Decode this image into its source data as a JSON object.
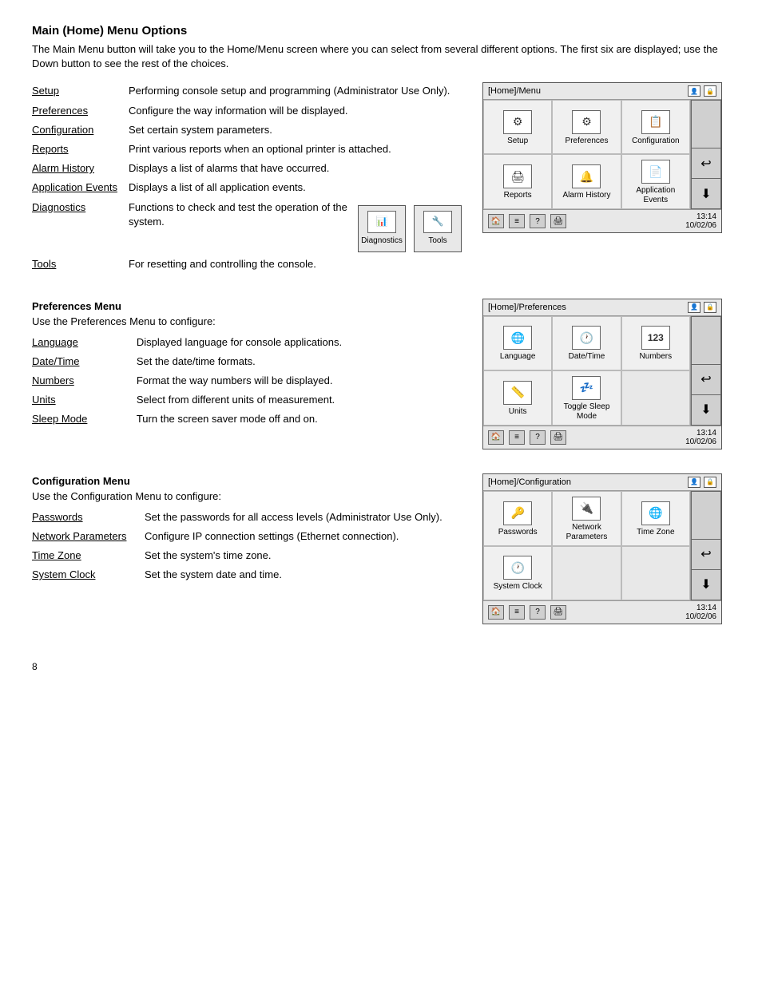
{
  "page": {
    "number": "8"
  },
  "main_section": {
    "title": "Main (Home) Menu Options",
    "intro": "The Main Menu button will take you to the Home/Menu screen where you can select from several different options. The first six are displayed; use the Down button to see the rest of the choices.",
    "items": [
      {
        "label": "Setup",
        "description": "Performing console setup and programming (Administrator Use Only)."
      },
      {
        "label": "Preferences",
        "description": "Configure the way information will be displayed."
      },
      {
        "label": "Configuration",
        "description": "Set certain system parameters."
      },
      {
        "label": "Reports",
        "description": "Print various reports when an optional printer is attached."
      },
      {
        "label": "Alarm History",
        "description": "Displays a list of alarms that have occurred."
      },
      {
        "label": "Application Events",
        "description": "Displays a list of all application events."
      },
      {
        "label": "Diagnostics",
        "description": "Functions to check and test the operation of the system."
      },
      {
        "label": "Tools",
        "description": "For resetting and controlling the console."
      }
    ],
    "screen": {
      "title": "[Home]/Menu",
      "time": "13:14",
      "date": "10/02/06",
      "row1": [
        "Setup",
        "Preferences",
        "Configuration"
      ],
      "row2": [
        "Reports",
        "Alarm History",
        "Application Events"
      ]
    }
  },
  "preferences_section": {
    "title": "Preferences Menu",
    "intro": "Use the Preferences Menu to configure:",
    "items": [
      {
        "label": "Language",
        "description": "Displayed language for console applications."
      },
      {
        "label": "Date/Time",
        "description": "Set the date/time formats."
      },
      {
        "label": "Numbers",
        "description": "Format the way numbers will be displayed."
      },
      {
        "label": "Units",
        "description": "Select from different units of measurement."
      },
      {
        "label": "Sleep Mode",
        "description": "Turn the screen saver mode off and on."
      }
    ],
    "screen": {
      "title": "[Home]/Preferences",
      "time": "13:14",
      "date": "10/02/06",
      "row1": [
        "Language",
        "Date/Time",
        "Numbers"
      ],
      "row2": [
        "Units",
        "Toggle Sleep Mode",
        ""
      ]
    }
  },
  "configuration_section": {
    "title": "Configuration Menu",
    "intro": "Use the Configuration Menu to configure:",
    "items": [
      {
        "label": "Passwords",
        "description": "Set the passwords for all access levels (Administrator Use Only)."
      },
      {
        "label": "Network Parameters",
        "description": "Configure IP connection settings (Ethernet connection)."
      },
      {
        "label": "Time Zone",
        "description": "Set the system's time zone."
      },
      {
        "label": "System Clock",
        "description": "Set the system date and time."
      }
    ],
    "screen": {
      "title": "[Home]/Configuration",
      "time": "13:14",
      "date": "10/02/06",
      "row1": [
        "Passwords",
        "Network Parameters",
        "Time Zone"
      ],
      "row2": [
        "System Clock",
        "",
        ""
      ]
    }
  }
}
